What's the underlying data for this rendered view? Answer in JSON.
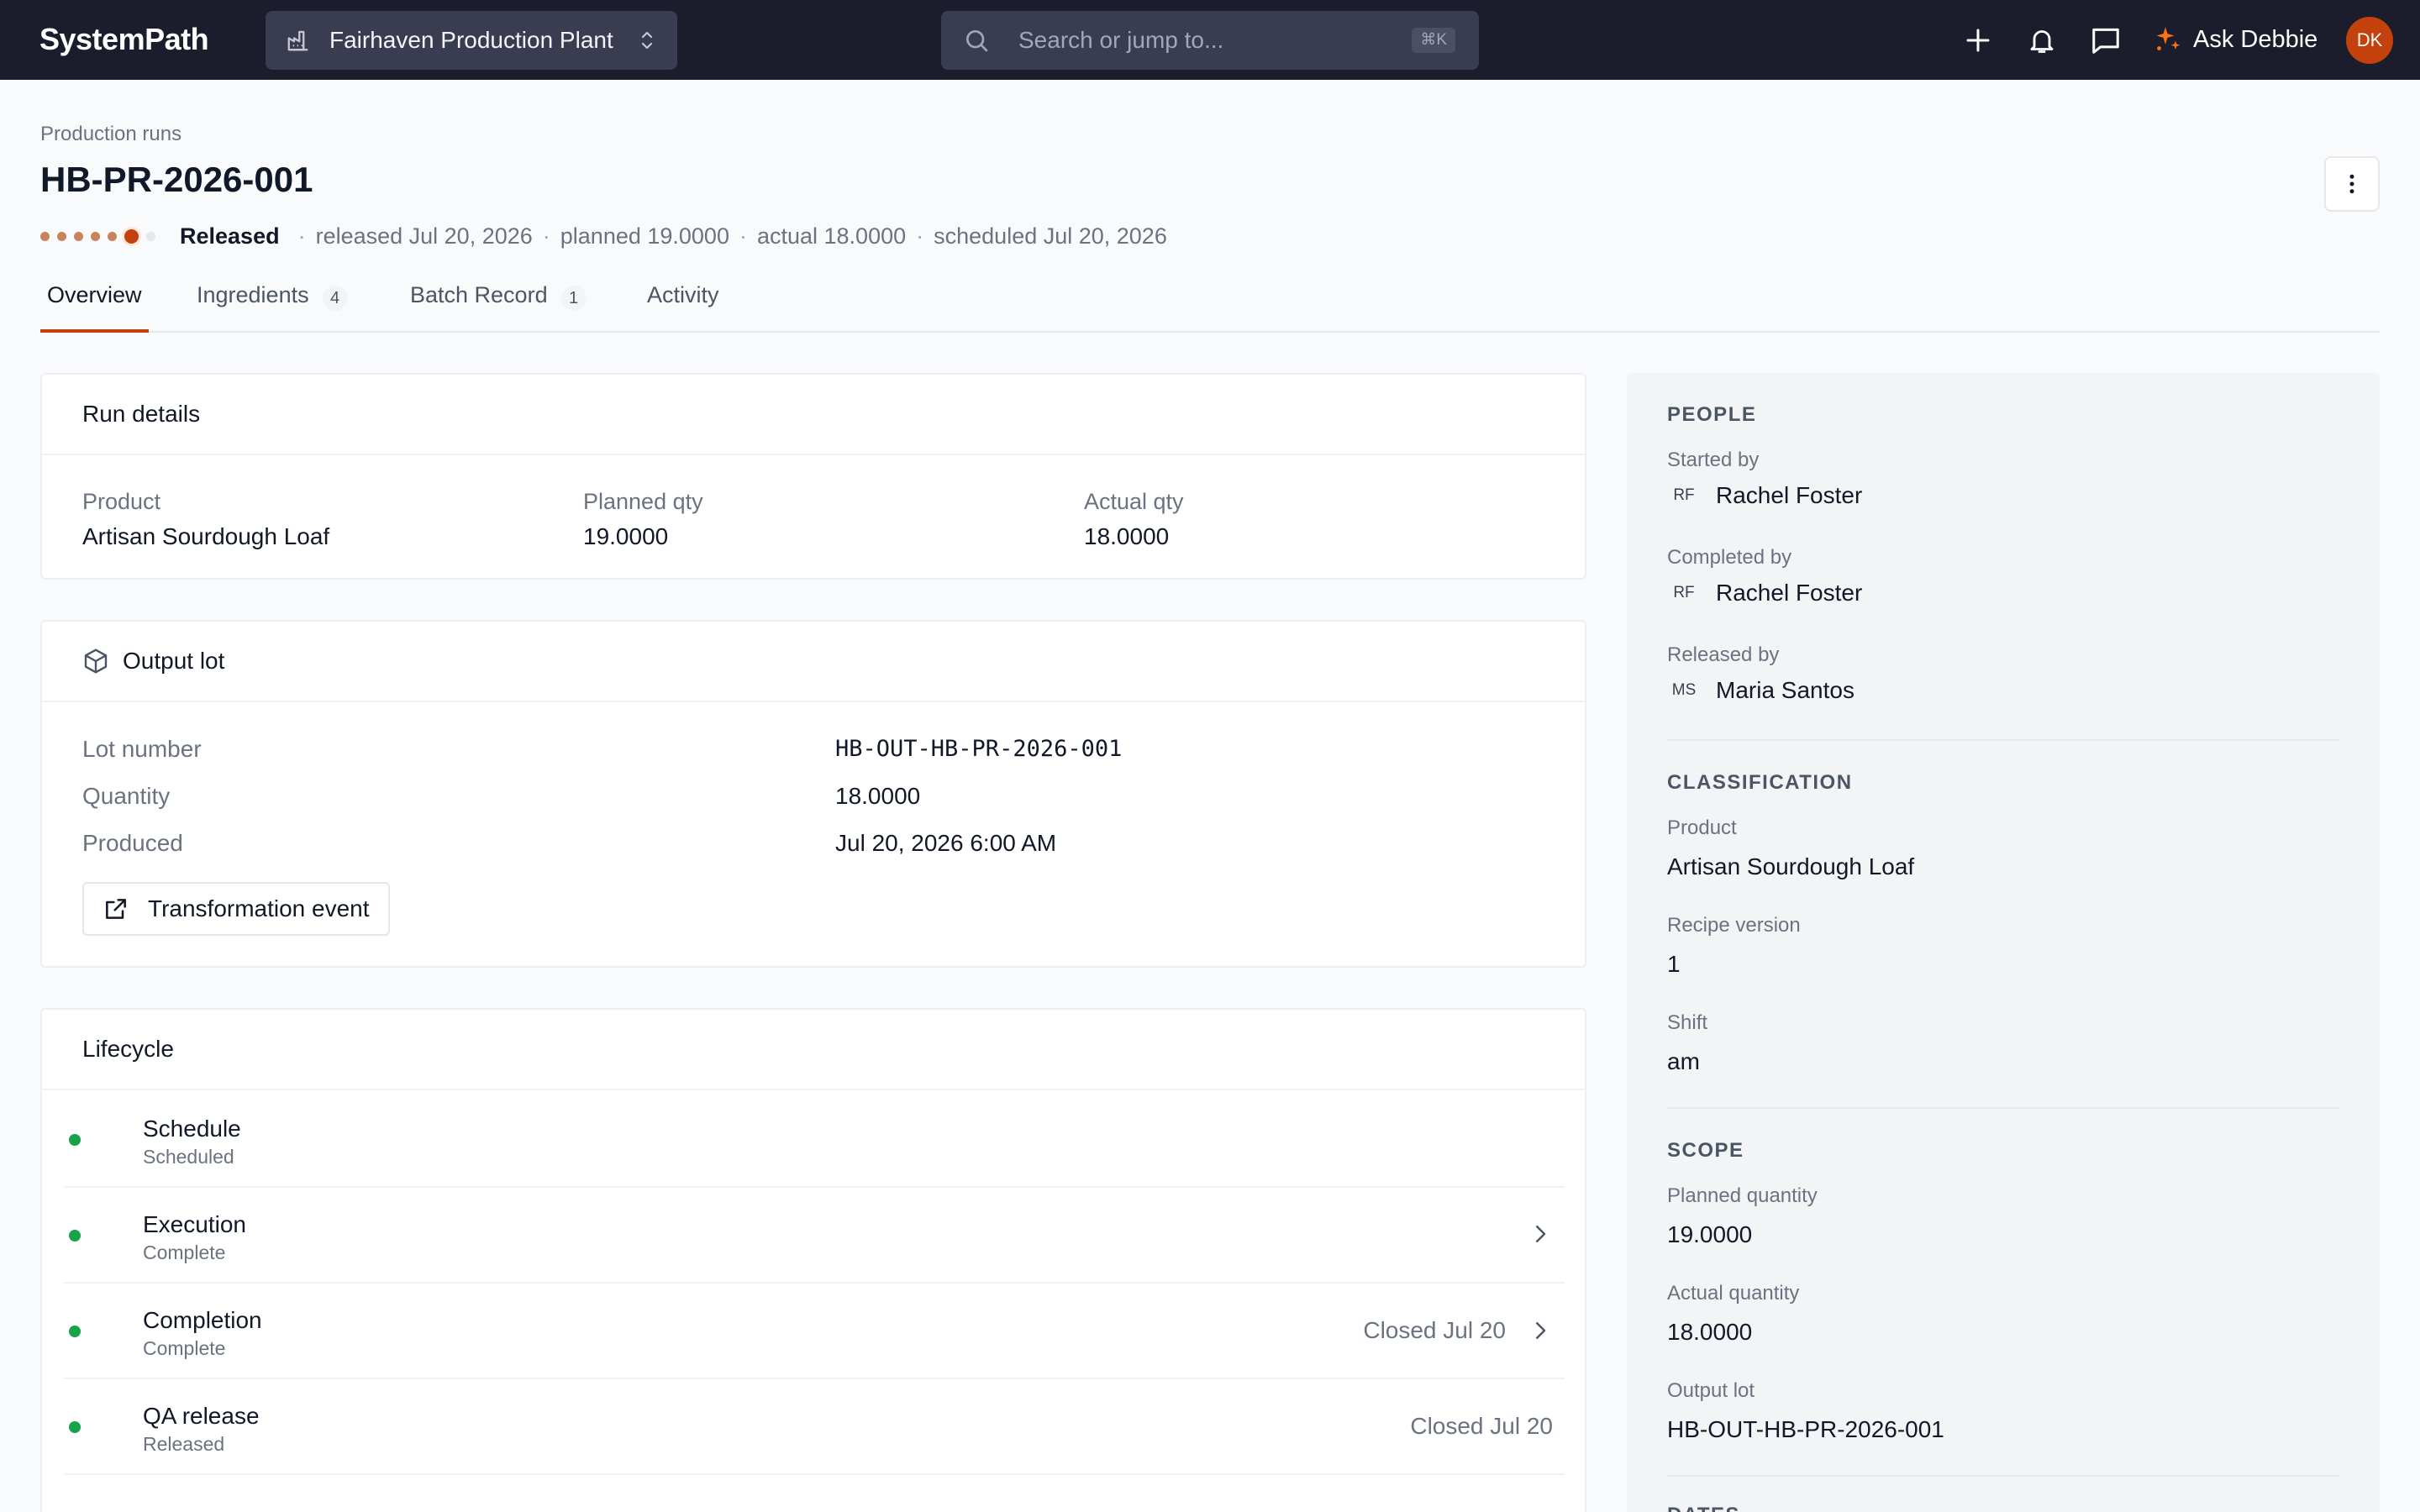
{
  "topbar": {
    "brand": "SystemPath",
    "plant": "Fairhaven Production Plant",
    "search_placeholder": "Search or jump to...",
    "search_shortcut": "⌘K",
    "ask_label": "Ask Debbie",
    "user_initials": "DK"
  },
  "header": {
    "breadcrumb": "Production runs",
    "title": "HB-PR-2026-001",
    "status": "Released",
    "meta": [
      "released Jul 20, 2026",
      "planned 19.0000",
      "actual 18.0000",
      "scheduled Jul 20, 2026"
    ],
    "progress_step": 6,
    "progress_total": 7
  },
  "tabs": [
    {
      "label": "Overview",
      "count": ""
    },
    {
      "label": "Ingredients",
      "count": "4"
    },
    {
      "label": "Batch Record",
      "count": "1"
    },
    {
      "label": "Activity",
      "count": ""
    }
  ],
  "run_details": {
    "title": "Run details",
    "product_label": "Product",
    "product_value": "Artisan Sourdough Loaf",
    "planned_label": "Planned qty",
    "planned_value": "19.0000",
    "actual_label": "Actual qty",
    "actual_value": "18.0000"
  },
  "output_lot": {
    "title": "Output lot",
    "lot_label": "Lot number",
    "lot_value": "HB-OUT-HB-PR-2026-001",
    "qty_label": "Quantity",
    "qty_value": "18.0000",
    "produced_label": "Produced",
    "produced_value": "Jul 20, 2026 6:00 AM",
    "event_button": "Transformation event"
  },
  "lifecycle": {
    "title": "Lifecycle",
    "rows": [
      {
        "title": "Schedule",
        "sub": "Scheduled",
        "right": ""
      },
      {
        "title": "Execution",
        "sub": "Complete",
        "right": ""
      },
      {
        "title": "Completion",
        "sub": "Complete",
        "right": "Closed Jul 20"
      },
      {
        "title": "QA release",
        "sub": "Released",
        "right": "Closed Jul 20"
      }
    ]
  },
  "side": {
    "people_title": "PEOPLE",
    "started_label": "Started by",
    "started_initials": "RF",
    "started_name": "Rachel Foster",
    "completed_label": "Completed by",
    "completed_initials": "RF",
    "completed_name": "Rachel Foster",
    "released_label": "Released by",
    "released_initials": "MS",
    "released_name": "Maria Santos",
    "class_title": "CLASSIFICATION",
    "product_label": "Product",
    "product_value": "Artisan Sourdough Loaf",
    "recipe_label": "Recipe version",
    "recipe_value": "1",
    "shift_label": "Shift",
    "shift_value": "am",
    "scope_title": "SCOPE",
    "planned_label": "Planned quantity",
    "planned_value": "19.0000",
    "actual_label": "Actual quantity",
    "actual_value": "18.0000",
    "lot_label": "Output lot",
    "lot_value": "HB-OUT-HB-PR-2026-001",
    "dates_title": "DATES"
  },
  "colors": {
    "topbar": "#1b1d2c",
    "accent": "#c2410c",
    "success": "#16a34a"
  }
}
